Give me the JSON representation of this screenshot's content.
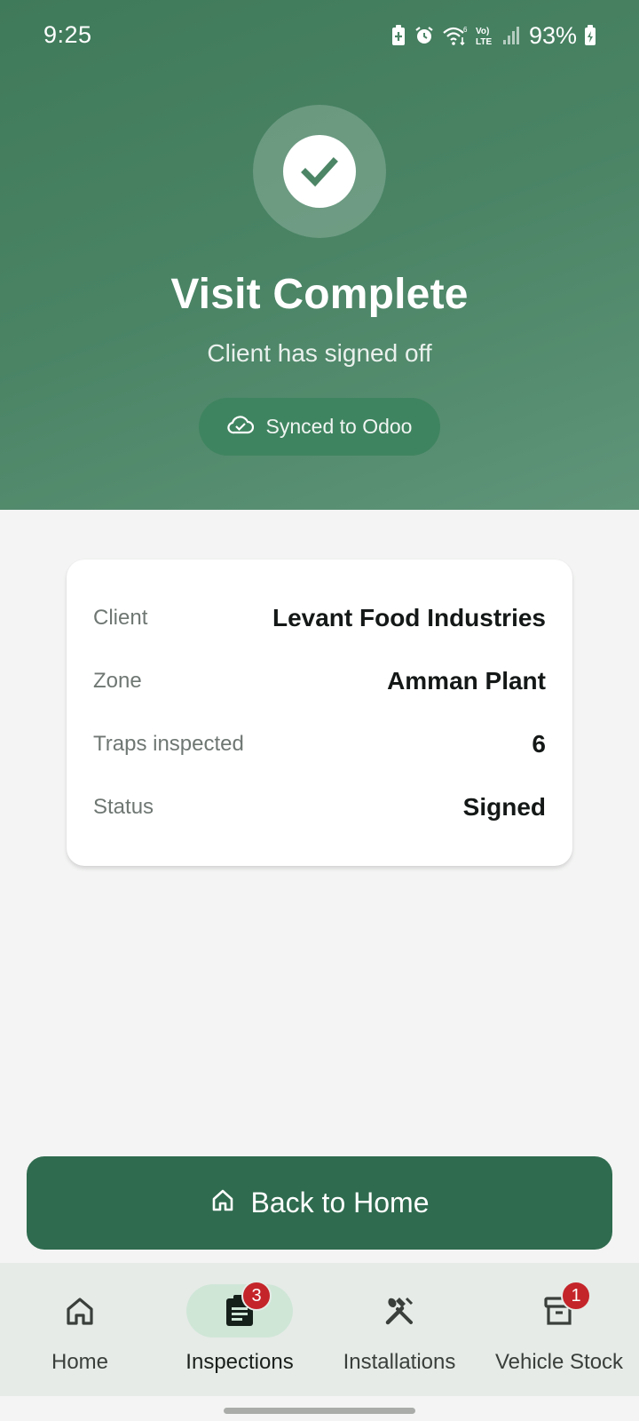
{
  "status_bar": {
    "time": "9:25",
    "battery": "93%",
    "network_label": "Vo) LTE",
    "wifi_label": "6",
    "icons": [
      "battery-saver-icon",
      "alarm-icon",
      "wifi-icon",
      "volte-icon",
      "signal-icon",
      "battery-charging-icon"
    ]
  },
  "hero": {
    "icon": "check-circle-icon",
    "title": "Visit Complete",
    "subtitle": "Client has signed off",
    "sync_label": "Synced to Odoo",
    "sync_icon": "cloud-check-icon"
  },
  "summary": {
    "rows": [
      {
        "label": "Client",
        "value": "Levant Food Industries"
      },
      {
        "label": "Zone",
        "value": "Amman Plant"
      },
      {
        "label": "Traps inspected",
        "value": "6"
      },
      {
        "label": "Status",
        "value": "Signed"
      }
    ]
  },
  "back_button": {
    "label": "Back to Home",
    "icon": "home-icon"
  },
  "bottom_nav": {
    "items": [
      {
        "label": "Home",
        "icon": "home-icon",
        "badge": null,
        "active": false
      },
      {
        "label": "Inspections",
        "icon": "clipboard-icon",
        "badge": "3",
        "active": true
      },
      {
        "label": "Installations",
        "icon": "tools-icon",
        "badge": null,
        "active": false
      },
      {
        "label": "Vehicle Stock",
        "icon": "archive-box-icon",
        "badge": "1",
        "active": false
      }
    ]
  },
  "colors": {
    "hero_gradient_start": "#3f7a5a",
    "hero_gradient_end": "#5f9479",
    "primary_button": "#2f6b4f",
    "badge": "#c4252a",
    "active_nav_pill": "#cfe6d7"
  }
}
